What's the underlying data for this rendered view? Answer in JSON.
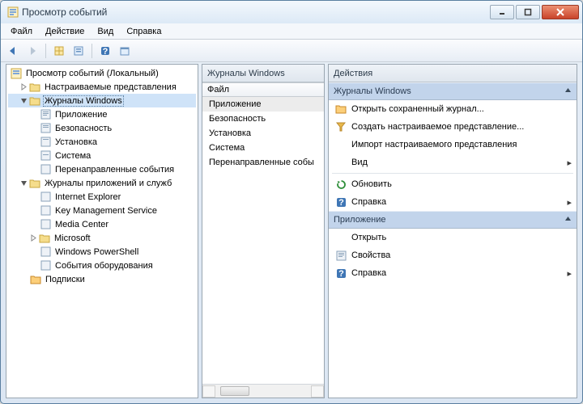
{
  "title": "Просмотр событий",
  "menu": {
    "file": "Файл",
    "action": "Действие",
    "view": "Вид",
    "help": "Справка"
  },
  "tree": {
    "root": "Просмотр событий (Локальный)",
    "custom_views": "Настраиваемые представления",
    "win_logs": "Журналы Windows",
    "win_children": {
      "app": "Приложение",
      "security": "Безопасность",
      "setup": "Установка",
      "system": "Система",
      "forwarded": "Перенаправленные события"
    },
    "app_svc": "Журналы приложений и служб",
    "app_children": {
      "ie": "Internet Explorer",
      "kms": "Key Management Service",
      "mc": "Media Center",
      "ms": "Microsoft",
      "ps": "Windows PowerShell",
      "hw": "События оборудования"
    },
    "subs": "Подписки"
  },
  "mid": {
    "header": "Журналы Windows",
    "col": "Файл",
    "items": {
      "app": "Приложение",
      "sec": "Безопасность",
      "setup": "Установка",
      "sys": "Система",
      "fwd": "Перенаправленные собы"
    }
  },
  "right": {
    "header": "Действия",
    "section1": "Журналы Windows",
    "open_saved": "Открыть сохраненный журнал...",
    "create_cv": "Создать настраиваемое представление...",
    "import_cv": "Импорт настраиваемого представления",
    "view": "Вид",
    "refresh": "Обновить",
    "help": "Справка",
    "section2": "Приложение",
    "open": "Открыть",
    "props": "Свойства",
    "help2": "Справка"
  }
}
